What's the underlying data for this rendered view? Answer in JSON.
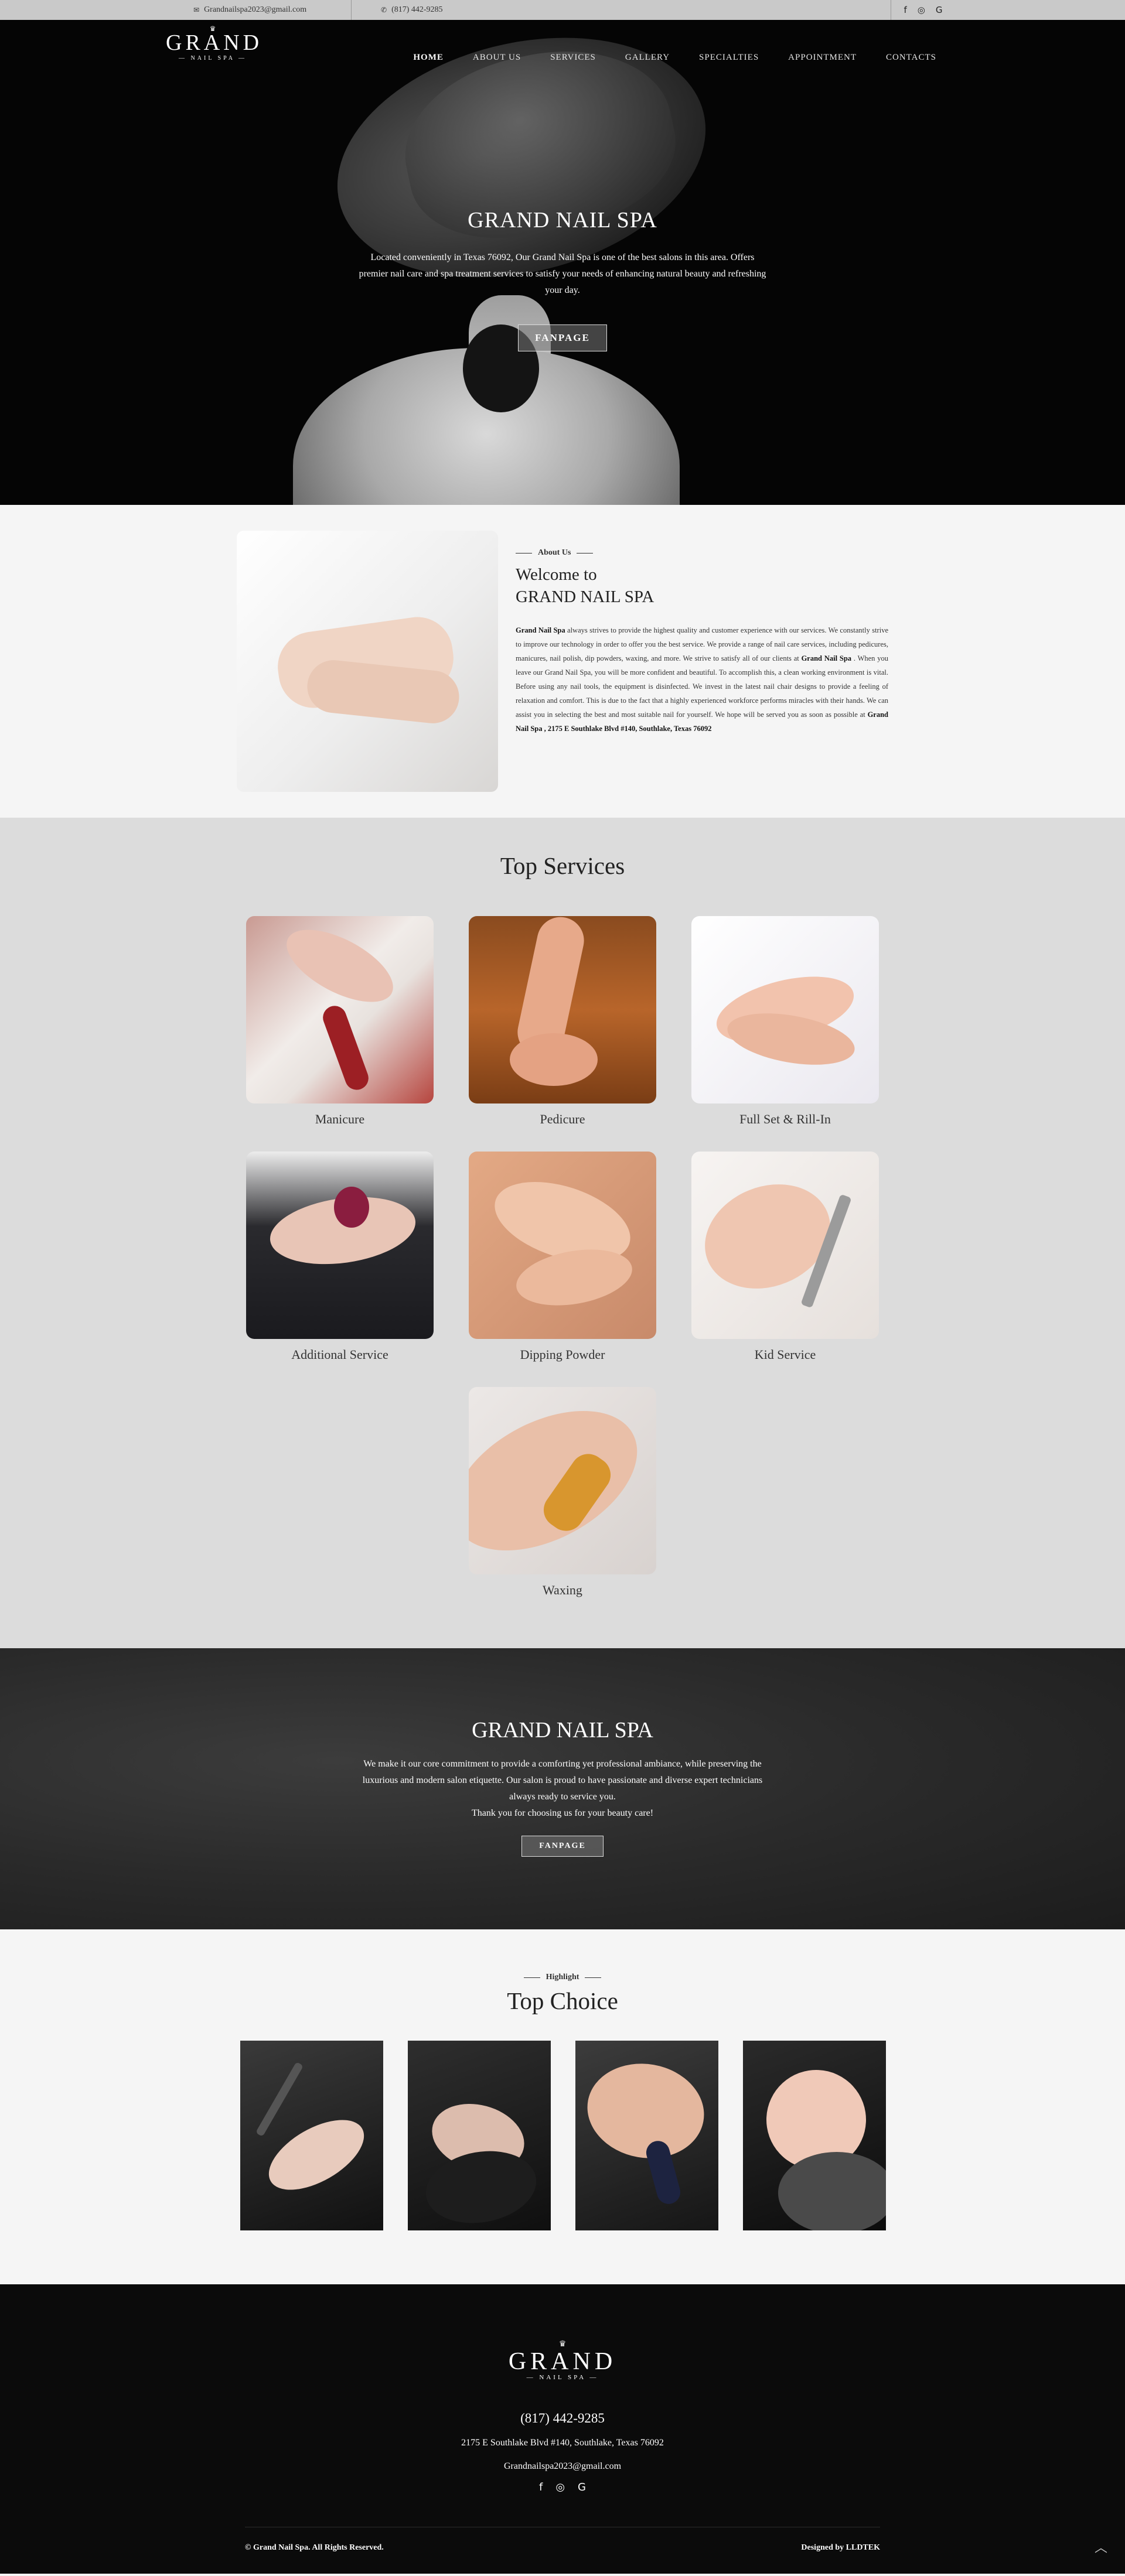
{
  "topbar": {
    "email": "Grandnailspa2023@gmail.com",
    "phone": "(817) 442-9285",
    "social_icons": [
      "facebook-icon",
      "instagram-icon",
      "google-icon"
    ],
    "social_glyphs": [
      "f",
      "◎",
      "G"
    ]
  },
  "logo": {
    "word": "GRAND",
    "sub": "NAIL SPA",
    "crown": "♛"
  },
  "nav": {
    "items": [
      "HOME",
      "ABOUT US",
      "SERVICES",
      "GALLERY",
      "SPECIALTIES",
      "APPOINTMENT",
      "CONTACTS"
    ],
    "active": "HOME"
  },
  "hero": {
    "title": "GRAND NAIL SPA",
    "text": "Located conveniently in Texas 76092, Our Grand Nail Spa is one of the best salons in this area. Offers premier nail care and spa treatment services to satisfy your needs of enhancing natural beauty and refreshing your day.",
    "button": "FANPAGE"
  },
  "about": {
    "eyebrow": "About Us",
    "heading_1": "Welcome to",
    "heading_2": "GRAND NAIL SPA",
    "brand_bold": "Grand Nail Spa",
    "p1": " always strives to provide the highest quality and customer experience with our services. We constantly strive to improve our technology in order to offer you the best service. We provide a range of nail care services, including pedicures, manicures, nail polish, dip powders, waxing, and more. We strive to satisfy all of our clients at ",
    "brand_bold_2": "Grand Nail Spa",
    "p2": " . When you leave our Grand Nail Spa, you will be more confident and beautiful. To accomplish this, a clean working environment is vital. Before using any nail tools, the equipment is disinfected. We invest in the latest nail chair designs to provide a feeling of relaxation and comfort. This is due to the fact that a highly experienced workforce performs miracles with their hands. We can assist you in selecting the best and most suitable nail for yourself. We hope will be served you as soon as possible at ",
    "address_bold": "Grand Nail Spa , 2175 E Southlake Blvd #140, Southlake, Texas 76092"
  },
  "services": {
    "title": "Top Services",
    "items": [
      {
        "label": "Manicure"
      },
      {
        "label": "Pedicure"
      },
      {
        "label": "Full Set & Rill-In"
      },
      {
        "label": "Additional Service"
      },
      {
        "label": "Dipping Powder"
      },
      {
        "label": "Kid Service"
      },
      {
        "label": "Waxing"
      }
    ]
  },
  "banner": {
    "title": "GRAND NAIL SPA",
    "line1": "We make it our core commitment to provide a comforting yet professional ambiance, while preserving the luxurious and modern salon etiquette. Our salon is proud to have passionate and diverse expert technicians always ready to service you.",
    "line2": "Thank you for choosing us for your beauty care!",
    "button": "FANPAGE"
  },
  "choice": {
    "eyebrow": "Highlight",
    "title": "Top Choice"
  },
  "footer": {
    "phone": "(817) 442-9285",
    "address": "2175 E Southlake Blvd #140, Southlake, Texas 76092",
    "email": "Grandnailspa2023@gmail.com",
    "copyright": "© Grand Nail Spa. All Rights Reserved.",
    "credit": "Designed by LLDTEK",
    "to_top": "︿"
  },
  "colors": {
    "topbar": "#c9c9c9",
    "hero_bg": "#050505",
    "services_bg": "#dcdcdc",
    "footer_bg": "#0b0b0b"
  }
}
